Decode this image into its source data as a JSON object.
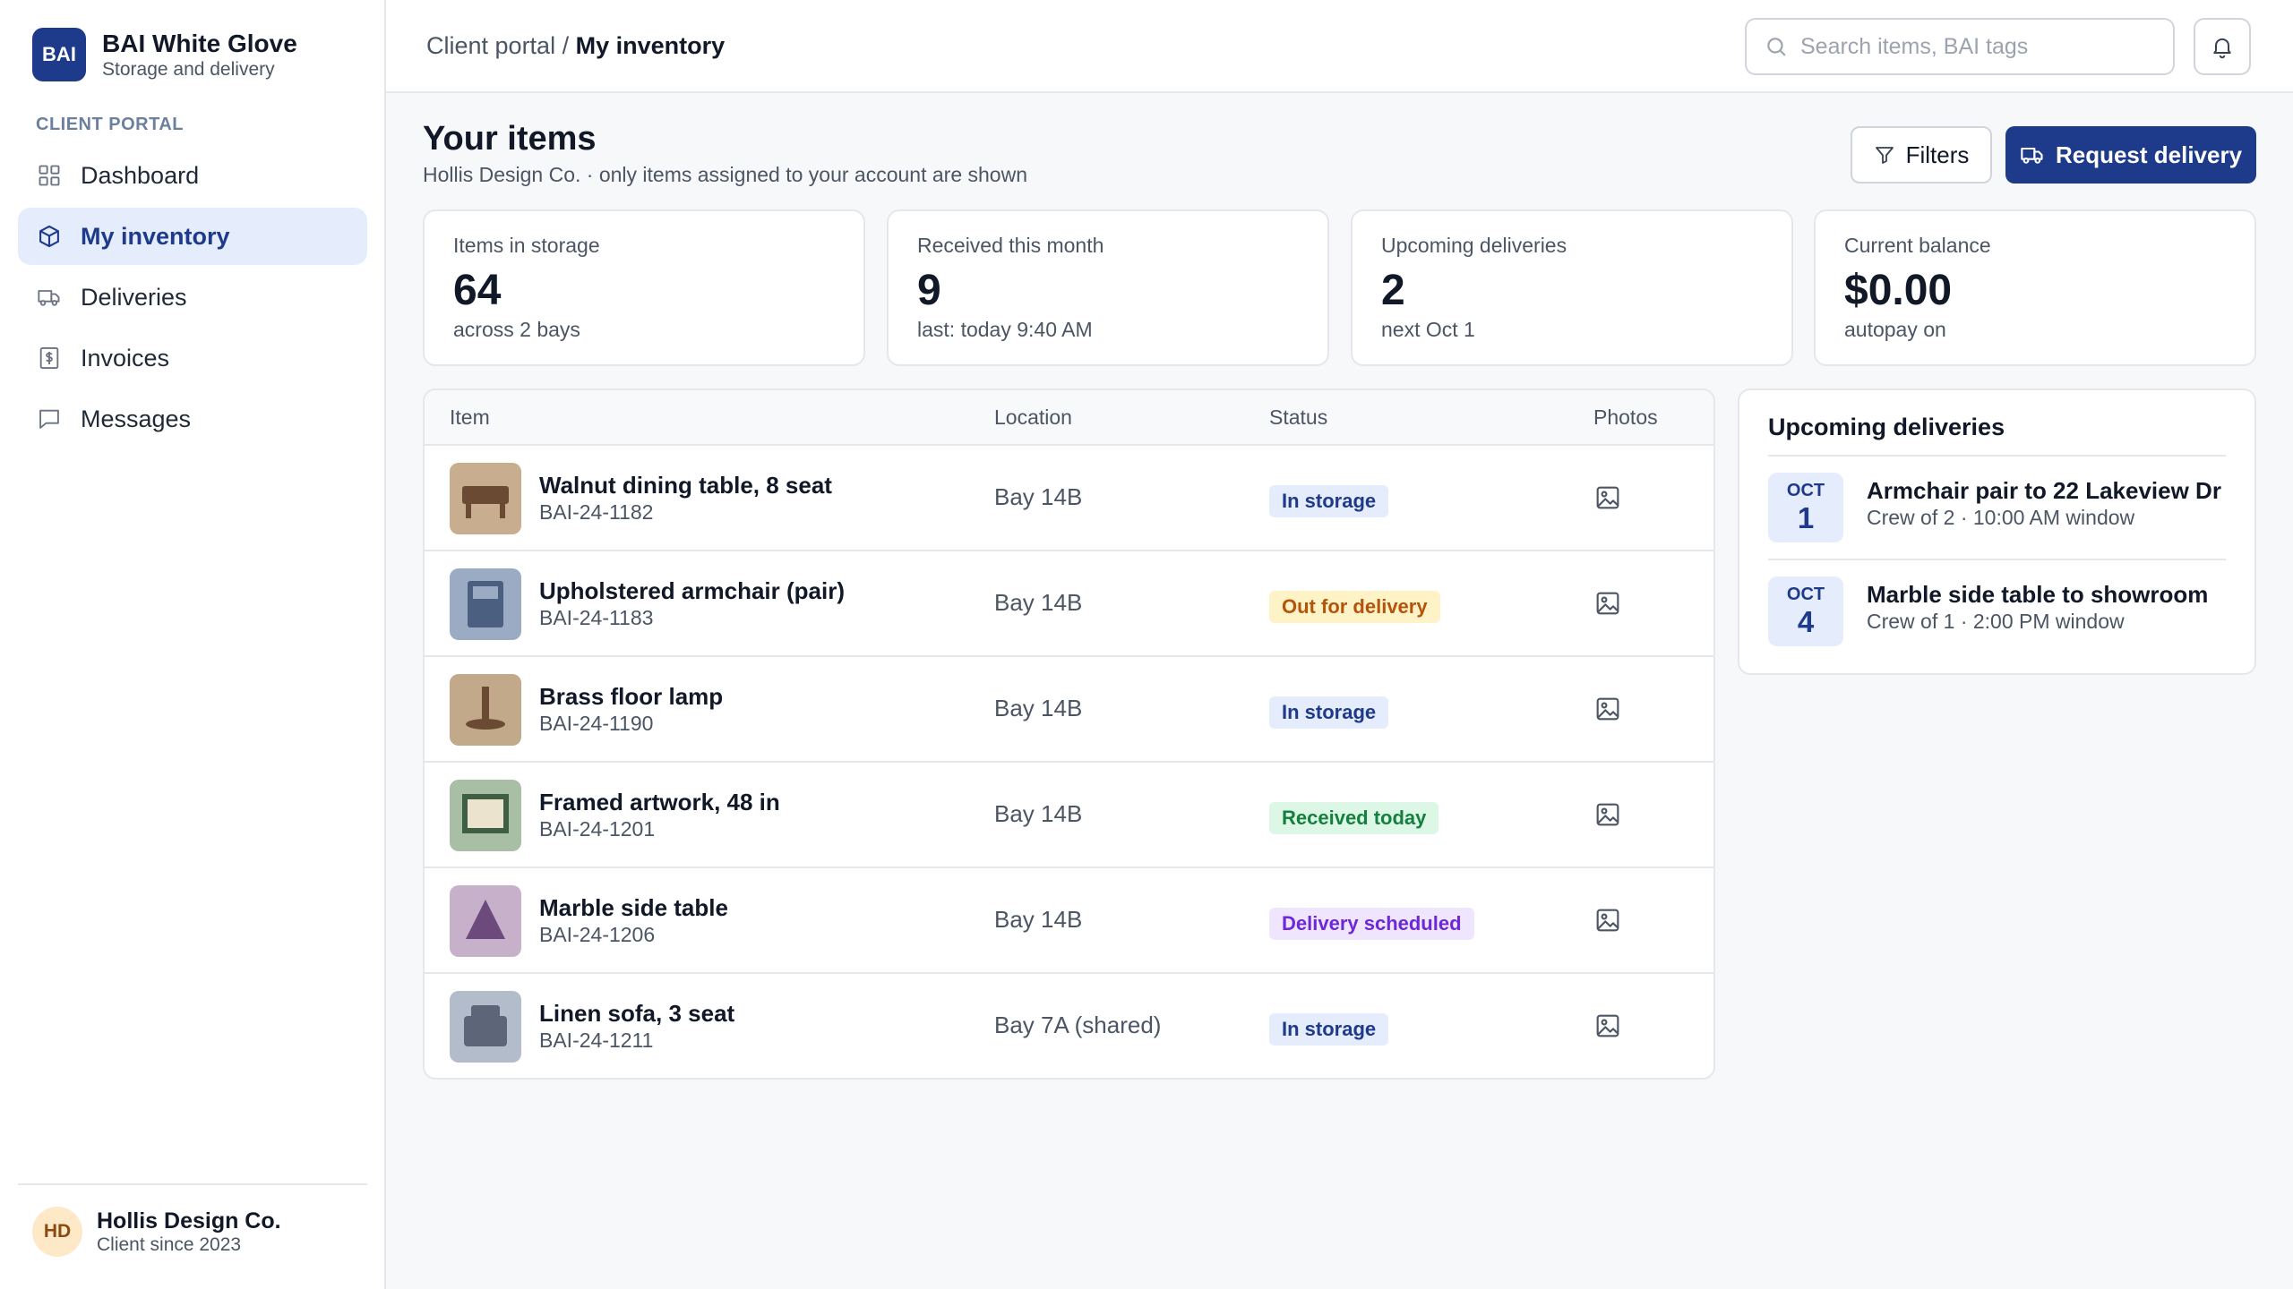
{
  "brand": {
    "logo": "BAI",
    "name": "BAI White Glove",
    "tagline": "Storage and delivery"
  },
  "sidebar": {
    "section_label": "CLIENT PORTAL",
    "items": [
      {
        "label": "Dashboard",
        "icon": "grid-icon",
        "active": false
      },
      {
        "label": "My inventory",
        "icon": "box-icon",
        "active": true
      },
      {
        "label": "Deliveries",
        "icon": "truck-icon",
        "active": false
      },
      {
        "label": "Invoices",
        "icon": "invoice-icon",
        "active": false
      },
      {
        "label": "Messages",
        "icon": "message-icon",
        "active": false
      }
    ],
    "account": {
      "initials": "HD",
      "name": "Hollis Design Co.",
      "since": "Client since 2023"
    }
  },
  "topbar": {
    "breadcrumb": {
      "parent": "Client portal",
      "separator": "/",
      "current": "My inventory"
    },
    "search": {
      "placeholder": "Search items, BAI tags",
      "value": ""
    }
  },
  "page": {
    "title": "Your items",
    "subtitle": "Hollis Design Co. · only items assigned to your account are shown",
    "filters_label": "Filters",
    "primary_label": "Request delivery"
  },
  "stats": [
    {
      "label": "Items in storage",
      "value": "64",
      "sub": "across 2 bays"
    },
    {
      "label": "Received this month",
      "value": "9",
      "sub": "last: today 9:40 AM"
    },
    {
      "label": "Upcoming deliveries",
      "value": "2",
      "sub": "next Oct 1"
    },
    {
      "label": "Current balance",
      "value": "$0.00",
      "sub": "autopay on"
    }
  ],
  "table": {
    "columns": {
      "item": "Item",
      "location": "Location",
      "status": "Status",
      "photos": "Photos"
    },
    "rows": [
      {
        "name": "Walnut dining table, 8 seat",
        "tag": "BAI-24-1182",
        "location": "Bay 14B",
        "status": "In storage",
        "status_kind": "storage",
        "thumb": "table-thumb"
      },
      {
        "name": "Upholstered armchair (pair)",
        "tag": "BAI-24-1183",
        "location": "Bay 14B",
        "status": "Out for delivery",
        "status_kind": "out",
        "thumb": "armchair-thumb"
      },
      {
        "name": "Brass floor lamp",
        "tag": "BAI-24-1190",
        "location": "Bay 14B",
        "status": "In storage",
        "status_kind": "storage",
        "thumb": "lamp-thumb"
      },
      {
        "name": "Framed artwork, 48 in",
        "tag": "BAI-24-1201",
        "location": "Bay 14B",
        "status": "Received today",
        "status_kind": "received",
        "thumb": "artwork-thumb"
      },
      {
        "name": "Marble side table",
        "tag": "BAI-24-1206",
        "location": "Bay 14B",
        "status": "Delivery scheduled",
        "status_kind": "scheduled",
        "thumb": "side-table-thumb"
      },
      {
        "name": "Linen sofa, 3 seat",
        "tag": "BAI-24-1211",
        "location": "Bay 7A (shared)",
        "status": "In storage",
        "status_kind": "storage",
        "thumb": "sofa-thumb"
      }
    ]
  },
  "upcoming": {
    "title": "Upcoming deliveries",
    "items": [
      {
        "month": "OCT",
        "day": "1",
        "title": "Armchair pair to 22 Lakeview Dr",
        "detail": "Crew of 2 · 10:00 AM window"
      },
      {
        "month": "OCT",
        "day": "4",
        "title": "Marble side table to showroom",
        "detail": "Crew of 1 · 2:00 PM window"
      }
    ]
  },
  "colors": {
    "accent": "#1e3a8a",
    "storage_badge": "#e5ecfb",
    "out_badge": "#fdf3c7",
    "received_badge": "#dcf7e6",
    "scheduled_badge": "#efe5fd"
  }
}
